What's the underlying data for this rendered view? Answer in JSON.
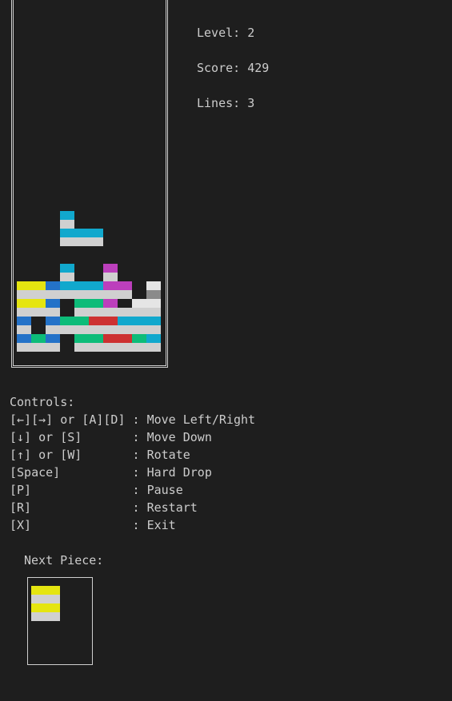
{
  "stats": {
    "level": "Level: 2",
    "score": "Score: 429",
    "lines": "Lines: 3"
  },
  "controls": {
    "title": "Controls:",
    "items": [
      "[←][→] or [A][D] : Move Left/Right",
      "[↓] or [S]       : Move Down",
      "[↑] or [W]       : Rotate",
      "[Space]          : Hard Drop",
      "[P]              : Pause",
      "[R]              : Restart",
      "[X]              : Exit"
    ]
  },
  "next_piece": {
    "label": "Next Piece:",
    "rows": [
      [
        "Y",
        "Y"
      ],
      [
        "W",
        "W"
      ],
      [
        "Y",
        "Y"
      ],
      [
        "W",
        "W"
      ]
    ]
  },
  "colors": {
    "Y": "#e5e510",
    "W": "#d0d0d0",
    "C": "#11a8cd",
    "B": "#2472c8",
    "G": "#0dbc79",
    "R": "#cd3131",
    "M": "#bc3fbc",
    "E": "#e5e5e5",
    "D": "#8a8a8a"
  },
  "board": {
    "columns": 10,
    "rows": [
      "..........",
      "..........",
      "..........",
      "..........",
      "..........",
      "..........",
      "..........",
      "..........",
      "..........",
      "..........",
      "..........",
      "..........",
      "..........",
      "..........",
      "..........",
      "..........",
      "..........",
      "..........",
      "..........",
      "..........",
      "..........",
      "..........",
      "..........",
      "..........",
      "...C......",
      "...W......",
      "...CCC....",
      "...WWW....",
      "..........",
      "..........",
      "...C..M...",
      "...W..W...",
      "YYBCCCMM.E",
      "WWWWWWWW.D",
      "YYB.GGM.EE",
      "WWW.WWWWWW",
      "B.BGGRRCCC",
      "W.WWWWWWWW",
      "BGB.GGRRGC",
      "WWW.WWWWWW"
    ]
  }
}
